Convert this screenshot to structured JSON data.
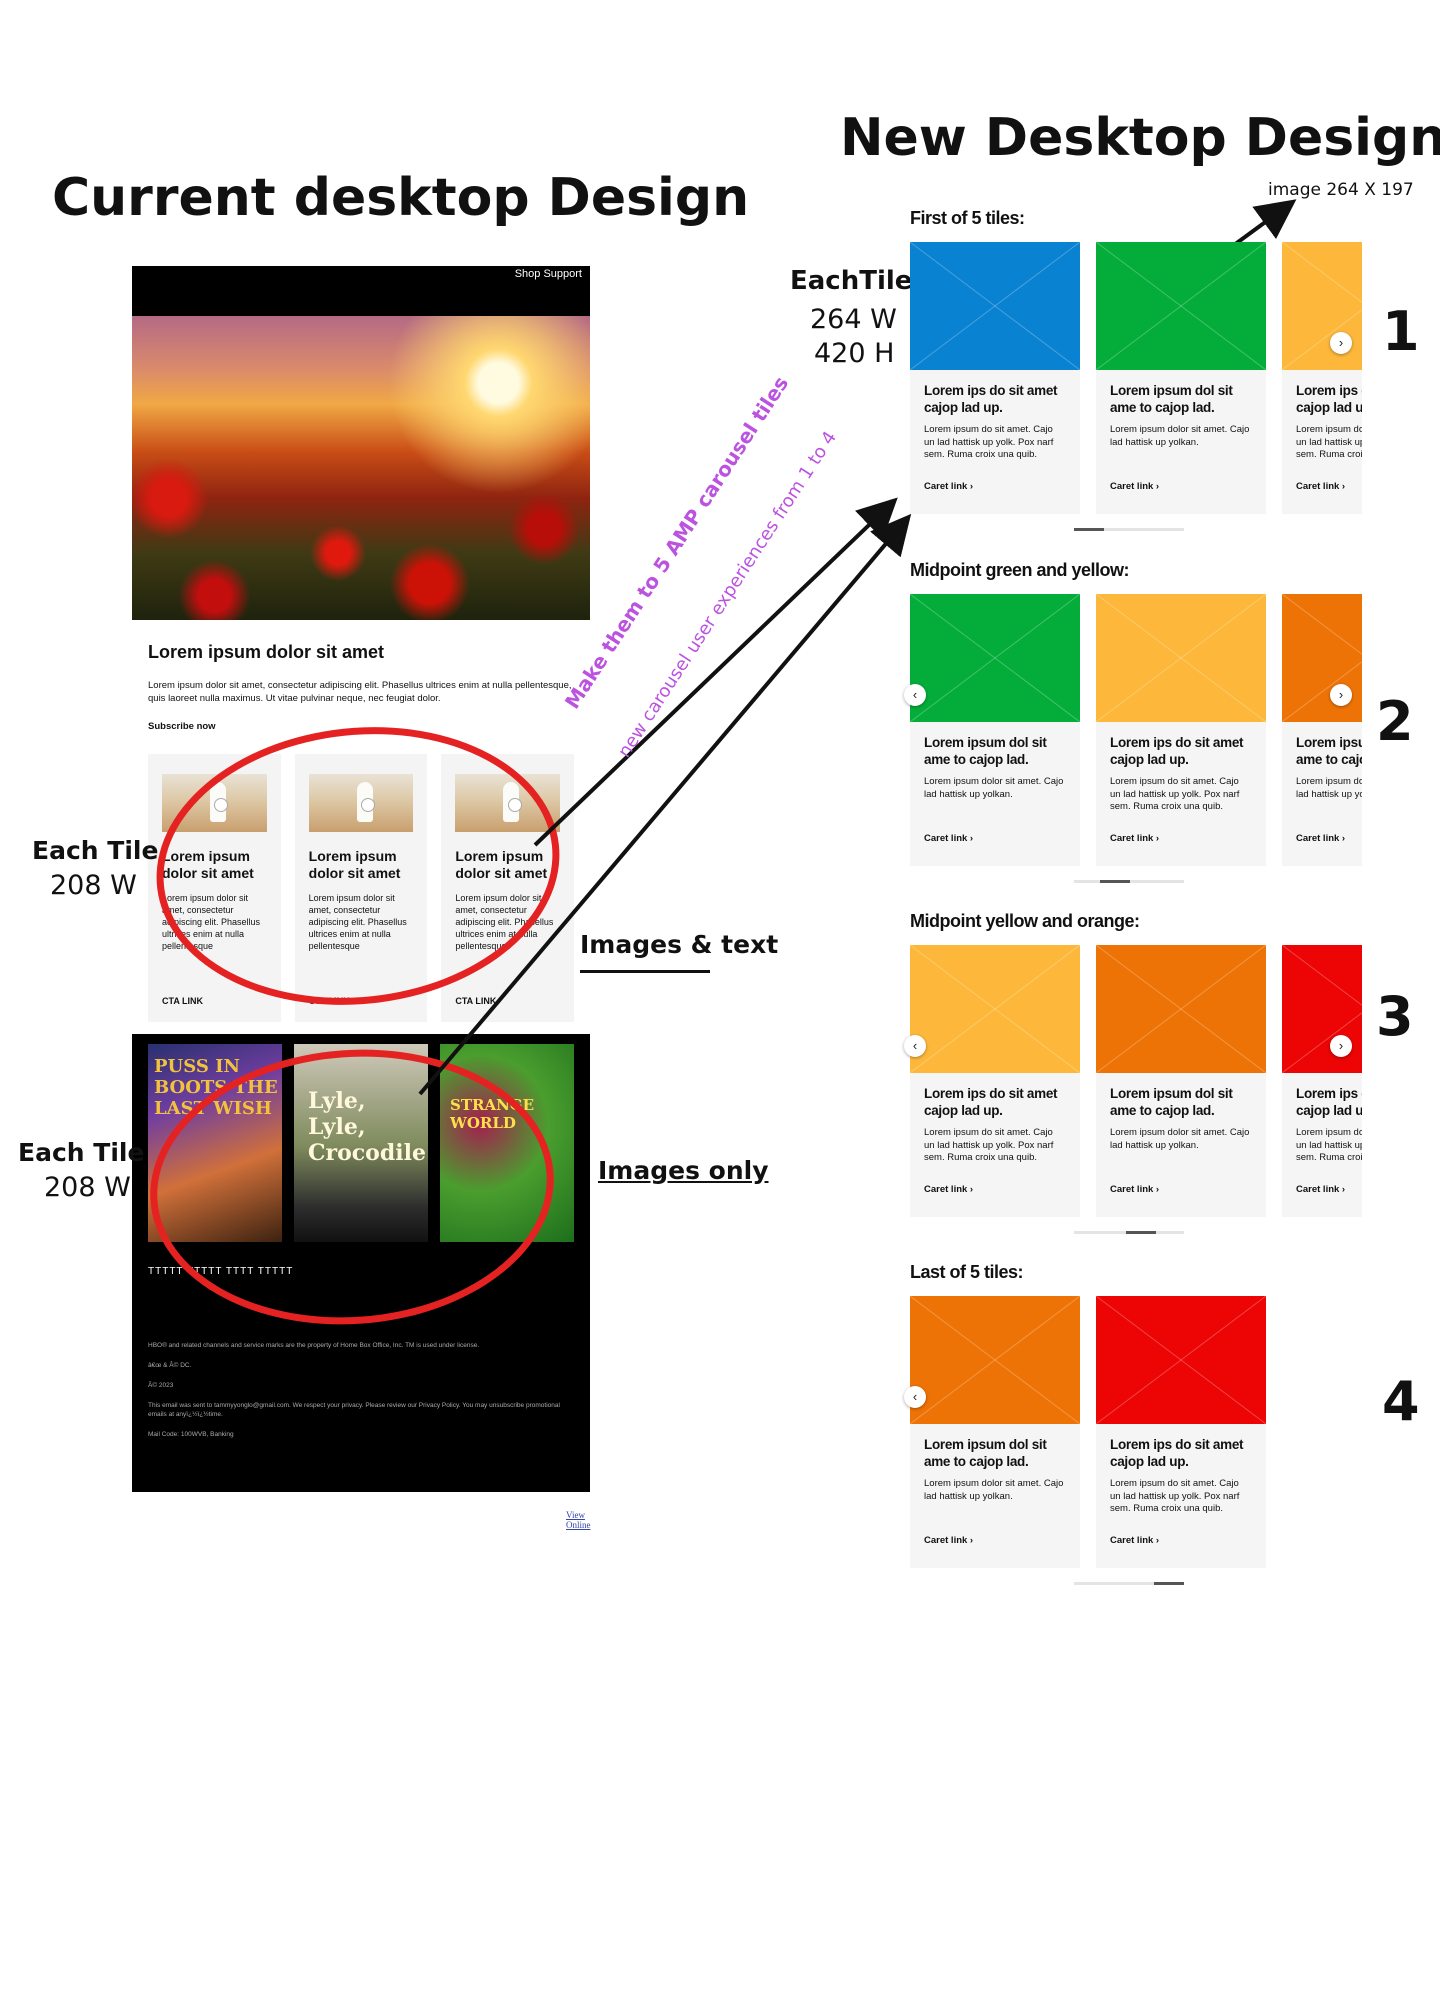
{
  "headings": {
    "current": "Current desktop Design",
    "new": "New Desktop Design"
  },
  "current_email": {
    "header_links": "Shop Support",
    "hero_title": "Lorem ipsum dolor sit amet",
    "hero_body": "Lorem ipsum dolor sit amet, consectetur adipiscing elit. Phasellus ultrices enim at nulla pellentesque, quis laoreet nulla maximus. Ut vitae pulvinar neque, nec feugiat dolor.",
    "subscribe": "Subscribe now",
    "tiles": [
      {
        "title": "Lorem ipsum dolor sit amet",
        "body": "Lorem ipsum dolor sit amet, consectetur adipiscing elit. Phasellus ultrices enim at nulla pellentesque",
        "cta": "CTA LINK"
      },
      {
        "title": "Lorem ipsum dolor sit amet",
        "body": "Lorem ipsum dolor sit amet, consectetur adipiscing elit. Phasellus ultrices enim at nulla pellentesque",
        "cta": "CTA LINK"
      },
      {
        "title": "Lorem ipsum dolor sit amet",
        "body": "Lorem ipsum dolor sit amet, consectetur adipiscing elit. Phasellus ultrices enim at nulla pellentesque",
        "cta": "CTA LINK"
      }
    ],
    "posters": [
      "PUSS IN BOOTS THE LAST WISH",
      "Lyle, Lyle, Crocodile",
      "STRANGE WORLD"
    ],
    "footer_marks": "TTTTT   TTTTT   TTTT               TTTTT",
    "legal": [
      "HBO® and related channels and service marks are the property of Home Box Office, Inc. TM is used under license.",
      "â€œ & Â© DC.",
      "Â© 2023",
      "This email was sent to tammyyonglo@gmail.com. We respect your privacy. Please review our Privacy Policy. You may unsubscribe promotional emails at anyï¿½ï¿½time.",
      "Mail Code: 100WVB, Banking"
    ],
    "view_online": "View Online"
  },
  "annotations": {
    "each_tile_1_label": "Each Tile",
    "each_tile_1_size": "208 W",
    "each_tile_2_label": "Each Tile",
    "each_tile_2_size": "208 W",
    "images_text": "Images  & text",
    "images_only": "Images only",
    "diag_1": "Make them to 5 AMP carousel tiles",
    "diag_2": "new carousel user experiences from 1 to 4",
    "new_each_tile_label": "EachTile",
    "new_each_tile_w": "264 W",
    "new_each_tile_h": "420 H",
    "image_size": "image 264 X 197"
  },
  "frames": [
    {
      "title": "First of 5 tiles:",
      "step": "1"
    },
    {
      "title": "Midpoint green and yellow:",
      "step": "2"
    },
    {
      "title": "Midpoint yellow and orange:",
      "step": "3"
    },
    {
      "title": "Last of 5 tiles:",
      "step": "4"
    }
  ],
  "carousel_tiles": [
    {
      "color": "#0a82d2",
      "title": "Lorem ips do sit amet cajop lad up.",
      "body": "Lorem ipsum do sit amet. Cajo un lad hattisk up yolk. Pox narf sem. Ruma croix una quib.",
      "cta": "Caret link"
    },
    {
      "color": "#04ad3a",
      "title": "Lorem ipsum dol sit ame to cajop lad.",
      "body": "Lorem ipsum dolor sit amet. Cajo lad hattisk up yolkan.",
      "cta": "Caret link"
    },
    {
      "color": "#fdb83b",
      "title": "Lorem ips do sit amet cajop lad up.",
      "body": "Lorem ipsum do sit amet. Cajo un lad hattisk up yolk. Pox narf sem. Ruma croix una quib.",
      "cta": "Caret link"
    },
    {
      "color": "#ee7306",
      "title": "Lorem ipsum dol sit ame to cajop lad.",
      "body": "Lorem ipsum dolor sit amet. Cajo lad hattisk up yolkan.",
      "cta": "Caret link"
    },
    {
      "color": "#ed0505",
      "title": "Lorem ips do sit amet cajop lad up.",
      "body": "Lorem ipsum do sit amet. Cajo un lad hattisk up yolk. Pox narf sem. Ruma croix una quib.",
      "cta": "Caret link"
    }
  ],
  "icons": {
    "prev": "chevron-left-icon",
    "next": "chevron-right-icon"
  }
}
